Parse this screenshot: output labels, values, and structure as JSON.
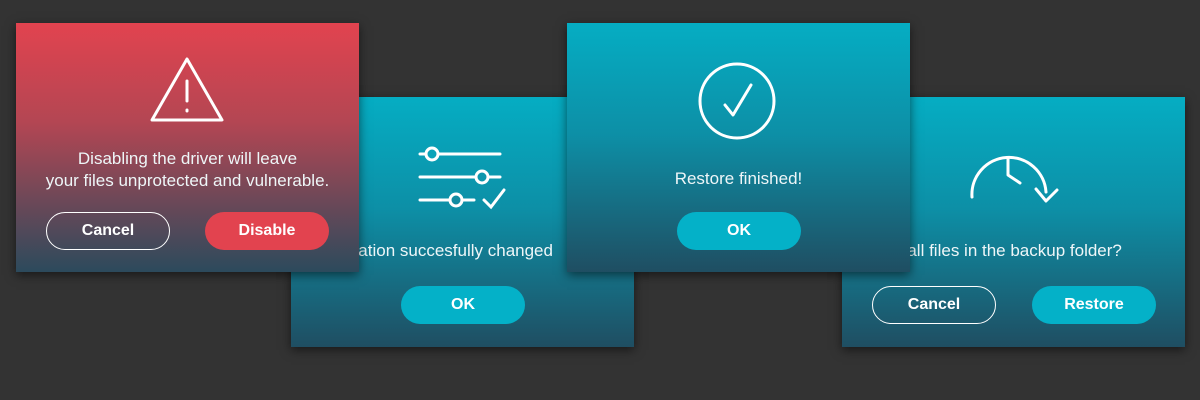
{
  "disable_dialog": {
    "message_line1": "Disabling the driver  will leave",
    "message_line2": "your files unprotected and vulnerable.",
    "cancel_label": "Cancel",
    "disable_label": "Disable",
    "icon": "warning-icon"
  },
  "config_dialog": {
    "message": "Configuration succesfully changed",
    "ok_label": "OK",
    "icon": "settings-sliders-icon"
  },
  "finished_dialog": {
    "message": "Restore finished!",
    "ok_label": "OK",
    "icon": "checkmark-circle-icon"
  },
  "restore_dialog": {
    "message": "Restore all files in the backup folder?",
    "cancel_label": "Cancel",
    "restore_label": "Restore",
    "icon": "restore-clock-icon"
  },
  "colors": {
    "background": "#333333",
    "teal_accent": "#04b1c8",
    "danger_red": "#e2434f"
  }
}
